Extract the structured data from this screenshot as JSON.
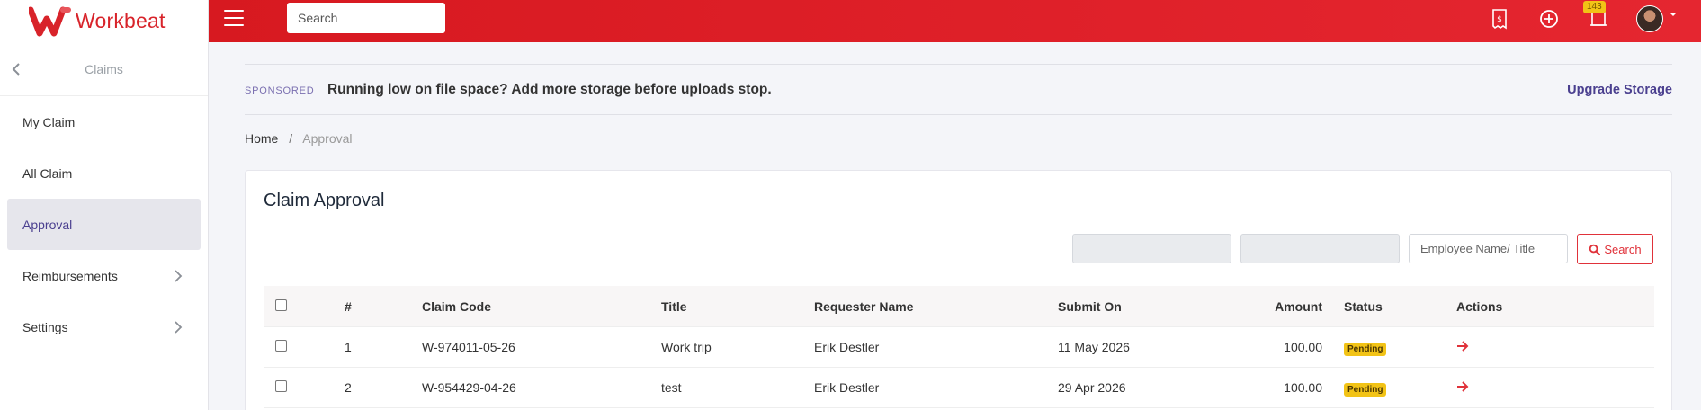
{
  "brand": {
    "name": "Workbeat",
    "color": "#d8232a",
    "logo_icon": "w-logo-icon"
  },
  "topbar": {
    "search_placeholder": "Search",
    "notification_count": "143",
    "icons": [
      "menu-icon",
      "receipt-icon",
      "plus-circle-icon",
      "notification-icon",
      "avatar"
    ]
  },
  "sidebar": {
    "title": "Claims",
    "items": [
      {
        "label": "My Claim",
        "has_submenu": false,
        "active": false
      },
      {
        "label": "All Claim",
        "has_submenu": false,
        "active": false
      },
      {
        "label": "Approval",
        "has_submenu": false,
        "active": true
      },
      {
        "label": "Reimbursements",
        "has_submenu": true,
        "active": false
      },
      {
        "label": "Settings",
        "has_submenu": true,
        "active": false
      }
    ]
  },
  "sponsored": {
    "tag": "SPONSORED",
    "message": "Running low on file space? Add more storage before uploads stop.",
    "link": "Upgrade Storage"
  },
  "breadcrumb": {
    "home": "Home",
    "separator": "/",
    "current": "Approval"
  },
  "card": {
    "title": "Claim Approval",
    "filters": {
      "name_placeholder": "Employee Name/ Title",
      "search_label": "Search"
    },
    "table": {
      "headers": [
        "#",
        "Claim Code",
        "Title",
        "Requester Name",
        "Submit On",
        "Amount",
        "Status",
        "Actions"
      ],
      "rows": [
        {
          "num": "1",
          "code": "W-974011-05-26",
          "title": "Work trip",
          "requester": "Erik Destler",
          "submitted": "11 May 2026",
          "amount": "100.00",
          "status": "Pending"
        },
        {
          "num": "2",
          "code": "W-954429-04-26",
          "title": "test",
          "requester": "Erik Destler",
          "submitted": "29 Apr 2026",
          "amount": "100.00",
          "status": "Pending"
        }
      ]
    }
  },
  "colors": {
    "topbar": "#e0232c",
    "accent": "#4a3f8f",
    "pending": "#f2c316"
  }
}
